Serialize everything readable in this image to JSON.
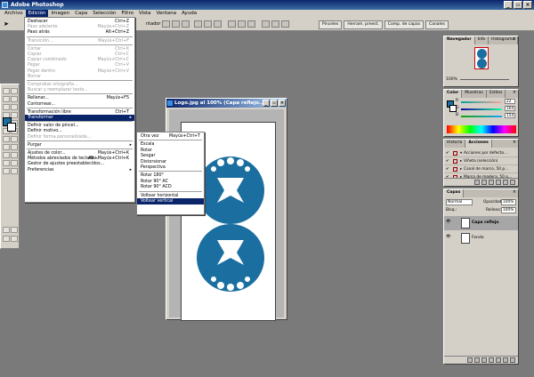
{
  "app": {
    "title": "Adobe Photoshop"
  },
  "menubar": [
    "Archivo",
    "Edición",
    "Imagen",
    "Capa",
    "Selección",
    "Filtro",
    "Vista",
    "Ventana",
    "Ayuda"
  ],
  "optionsbar": {
    "fragment": "ntador",
    "wells": [
      "Pinceles",
      "Herram. preest.",
      "Comp. de capas",
      "Canales"
    ]
  },
  "edit_menu": {
    "items": [
      {
        "label": "Deshacer",
        "sc": "Ctrl+Z",
        "dis": false
      },
      {
        "label": "Paso adelante",
        "sc": "Mayús+Ctrl+Z",
        "dis": true
      },
      {
        "label": "Paso atrás",
        "sc": "Alt+Ctrl+Z",
        "dis": false
      },
      {
        "sep": true
      },
      {
        "label": "Transición...",
        "sc": "Mayús+Ctrl+F",
        "dis": true
      },
      {
        "sep": true
      },
      {
        "label": "Cortar",
        "sc": "Ctrl+X",
        "dis": true
      },
      {
        "label": "Copiar",
        "sc": "Ctrl+C",
        "dis": true
      },
      {
        "label": "Copiar combinado",
        "sc": "Mayús+Ctrl+C",
        "dis": true
      },
      {
        "label": "Pegar",
        "sc": "Ctrl+V",
        "dis": true
      },
      {
        "label": "Pegar dentro",
        "sc": "Mayús+Ctrl+V",
        "dis": true
      },
      {
        "label": "Borrar",
        "sc": "",
        "dis": true
      },
      {
        "sep": true
      },
      {
        "label": "Comprobar ortografía...",
        "sc": "",
        "dis": true
      },
      {
        "label": "Buscar y reemplazar texto...",
        "sc": "",
        "dis": true
      },
      {
        "sep": true
      },
      {
        "label": "Rellenar...",
        "sc": "Mayús+F5",
        "dis": false
      },
      {
        "label": "Contornear...",
        "sc": "",
        "dis": false
      },
      {
        "sep": true
      },
      {
        "label": "Transformación libre",
        "sc": "Ctrl+T",
        "dis": false
      },
      {
        "label": "Transformar",
        "sc": "",
        "dis": false,
        "hl": true,
        "sub": true
      },
      {
        "sep": true
      },
      {
        "label": "Definir valor de pincel...",
        "sc": "",
        "dis": false
      },
      {
        "label": "Definir motivo...",
        "sc": "",
        "dis": false
      },
      {
        "label": "Definir forma personalizada...",
        "sc": "",
        "dis": true
      },
      {
        "sep": true
      },
      {
        "label": "Purgar",
        "sc": "",
        "dis": false,
        "sub": true
      },
      {
        "sep": true
      },
      {
        "label": "Ajustes de color...",
        "sc": "Mayús+Ctrl+K",
        "dis": false
      },
      {
        "label": "Métodos abreviados de teclado...",
        "sc": "Alt+Mayús+Ctrl+K",
        "dis": false
      },
      {
        "label": "Gestor de ajustes preestablecidos...",
        "sc": "",
        "dis": false
      },
      {
        "label": "Preferencias",
        "sc": "",
        "dis": false,
        "sub": true
      }
    ]
  },
  "transform_menu": {
    "items": [
      {
        "label": "Otra vez",
        "sc": "Mayús+Ctrl+T"
      },
      {
        "sep": true
      },
      {
        "label": "Escala"
      },
      {
        "label": "Rotar"
      },
      {
        "label": "Sesgar"
      },
      {
        "label": "Distorsionar"
      },
      {
        "label": "Perspectiva"
      },
      {
        "sep": true
      },
      {
        "label": "Rotar 180°"
      },
      {
        "label": "Rotar 90° AC"
      },
      {
        "label": "Rotar 90° ACD"
      },
      {
        "sep": true
      },
      {
        "label": "Voltear horizontal"
      },
      {
        "label": "Voltear vertical",
        "hl": true
      }
    ]
  },
  "document": {
    "title": "Logo.jpg al 100% (Capa reflejo..."
  },
  "navigator": {
    "tabs": [
      "Navegador",
      "Info",
      "Histograma"
    ],
    "zoom": "100%"
  },
  "color": {
    "tabs": [
      "Color",
      "Muestras",
      "Estilos"
    ],
    "r": "22",
    "g": "164",
    "b": "154",
    "r_lab": "R",
    "g_lab": "G",
    "b_lab": "B"
  },
  "actions": {
    "tabs": [
      "Historia",
      "Acciones"
    ],
    "rows": [
      "Acciones por defecto...",
      "Viñeta (selección)",
      "Canal de marco, 50 p...",
      "Marco de madera, 50 p..."
    ]
  },
  "layers": {
    "tabs": [
      "Capas"
    ],
    "mode": "Normal",
    "opacity_lab": "Opacidad:",
    "opacity": "100%",
    "fill_lab": "Relleno:",
    "fill": "100%",
    "lock_lab": "Bloq.:",
    "layer1": "Capa reflejo",
    "layer2": "Fondo"
  },
  "colors": {
    "brand": "#1a6fa0",
    "titlebar": "#0a246a"
  }
}
